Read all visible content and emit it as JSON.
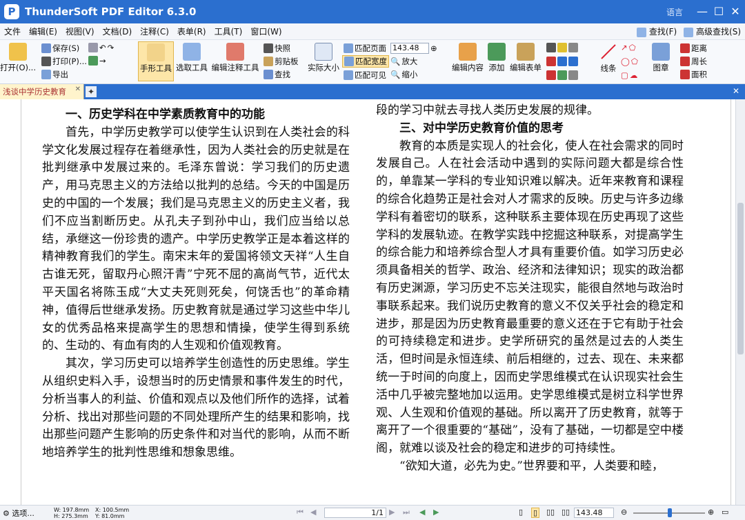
{
  "app": {
    "title": "ThunderSoft PDF Editor 6.3.0",
    "language": "语言",
    "logo": "P"
  },
  "menu": {
    "items": [
      "文件",
      "编辑(E)",
      "视图(V)",
      "文档(D)",
      "注释(C)",
      "表单(R)",
      "工具(T)",
      "窗口(W)"
    ],
    "find": "查找(F)",
    "advanced_find": "高级查找(S)"
  },
  "toolbar": {
    "open": "打开(O)...",
    "save": "保存(S)",
    "print": "打印(P)...",
    "export": "导出",
    "hand": "手形工具",
    "select": "选取工具",
    "edit_annot": "编辑注释工具",
    "snapshot": "快照",
    "clipboard": "剪贴板",
    "find": "查找",
    "actual_size": "实际大小",
    "fit_page": "匹配页面",
    "fit_width": "匹配宽度",
    "fit_visible": "匹配可见",
    "zoom_value": "143.48",
    "zoom_in": "放大",
    "zoom_out": "缩小",
    "edit_content": "编辑内容",
    "add": "添加",
    "edit_form": "编辑表单",
    "line": "线条",
    "chapter": "图章",
    "distance": "距离",
    "perimeter": "周长",
    "area": "面积"
  },
  "tab": {
    "name": "浅谈中学历史教育"
  },
  "document": {
    "left": {
      "heading": "一、历史学科在中学素质教育中的功能",
      "p1": "首先，中学历史教学可以使学生认识到在人类社会的科学文化发展过程存在着继承性，因为人类社会的历史就是在批判继承中发展过来的。毛泽东曾说：学习我们的历史遗产，用马克思主义的方法给以批判的总结。今天的中国是历史的中国的一个发展；我们是马克思主义的历史主义者，我们不应当割断历史。从孔夫子到孙中山，我们应当给以总结，承继这一份珍贵的遗产。中学历史教学正是本着这样的精神教育我们的学生。南宋末年的爱国将领文天祥“人生自古谁无死，留取丹心照汗青”宁死不屈的高尚气节，近代太平天国名将陈玉成“大丈夫死则死矣，何饶舌也”的革命精神，值得后世继承发扬。历史教育就是通过学习这些中华儿女的优秀品格来提高学生的思想和情操，使学生得到系统的、生动的、有血有肉的人生观和价值观教育。",
      "p2": "其次，学习历史可以培养学生创造性的历史思维。学生从组织史料入手，设想当时的历史情景和事件发生的时代，分析当事人的利益、价值和观点以及他们所作的选择，试着分析、找出对那些问题的不同处理所产生的结果和影响，找出那些问题产生影响的历史条件和对当代的影响，从而不断地培养学生的批判性思维和想象思维。"
    },
    "right": {
      "lead": "段的学习中就去寻找人类历史发展的规律。",
      "heading": "三、对中学历史教育价值的思考",
      "p1": "教育的本质是实现人的社会化，使人在社会需求的同时发展自己。人在社会活动中遇到的实际问题大都是综合性的，单靠某一学科的专业知识难以解决。近年来教育和课程的综合化趋势正是社会对人才需求的反映。历史与许多边缘学科有着密切的联系，这种联系主要体现在历史再现了这些学科的发展轨迹。在教学实践中挖掘这种联系，对提高学生的综合能力和培养综合型人才具有重要价值。如学习历史必须具备相关的哲学、政治、经济和法律知识；现实的政治都有历史渊源，学习历史不忘关注现实，能很自然地与政治时事联系起来。我们说历史教育的意义不仅关乎社会的稳定和进步，那是因为历史教育最重要的意义还在于它有助于社会的可持续稳定和进步。史学所研究的虽然是过去的人类生活，但时间是永恒连续、前后相继的，过去、现在、未来都统一于时间的向度上，因而史学思维模式在认识现实社会生活中几乎被完整地加以运用。史学思维模式是树立科学世界观、人生观和价值观的基础。所以离开了历史教育，就等于离开了一个很重要的“基础”，没有了基础，一切都是空中楼阁，就难以谈及社会的稳定和进步的可持续性。",
      "p2": "“欲知大道，必先为史。”世界要和平，人类要和睦，"
    }
  },
  "status": {
    "options": "选项...",
    "w": "W: 197.8mm",
    "h": "H: 275.3mm",
    "x": "X: 100.5mm",
    "y": "Y: 81.0mm",
    "page": "1/1",
    "zoom": "143.48"
  }
}
